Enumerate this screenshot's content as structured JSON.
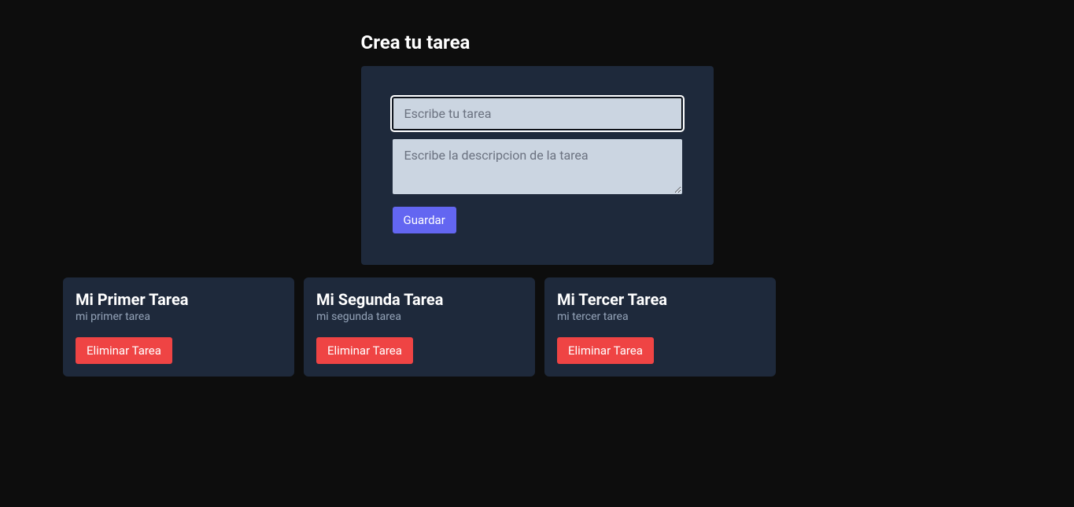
{
  "form": {
    "heading": "Crea tu tarea",
    "title_input": {
      "placeholder": "Escribe tu tarea",
      "value": ""
    },
    "description_input": {
      "placeholder": "Escribe la descripcion de la tarea",
      "value": ""
    },
    "save_button_label": "Guardar"
  },
  "tasks": [
    {
      "title": "Mi Primer Tarea",
      "description": "mi primer tarea",
      "delete_label": "Eliminar Tarea"
    },
    {
      "title": "Mi Segunda Tarea",
      "description": "mi segunda tarea",
      "delete_label": "Eliminar Tarea"
    },
    {
      "title": "Mi Tercer Tarea",
      "description": "mi tercer tarea",
      "delete_label": "Eliminar Tarea"
    }
  ]
}
